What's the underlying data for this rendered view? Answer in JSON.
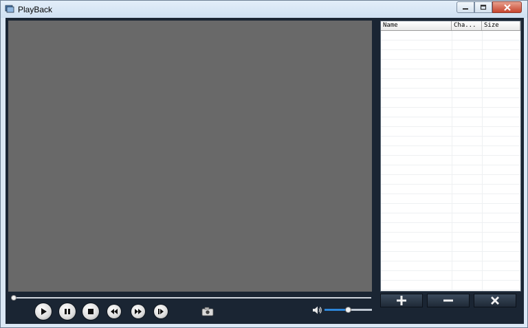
{
  "window": {
    "title": "PlayBack",
    "controls": {
      "minimize": "minimize-icon",
      "maximize": "maximize-icon",
      "close": "close-icon"
    }
  },
  "player": {
    "seek_progress": 0.0,
    "volume_level": 0.5,
    "buttons": [
      {
        "name": "play-button",
        "icon": "play-icon"
      },
      {
        "name": "pause-button",
        "icon": "pause-icon"
      },
      {
        "name": "stop-button",
        "icon": "stop-icon"
      },
      {
        "name": "rewind-button",
        "icon": "rewind-icon"
      },
      {
        "name": "fast-forward-button",
        "icon": "fast-forward-icon"
      },
      {
        "name": "step-frame-button",
        "icon": "step-frame-icon"
      }
    ],
    "snapshot_icon": "camera-icon",
    "volume_icon": "speaker-icon"
  },
  "playlist": {
    "columns": [
      "Name",
      "Cha...",
      "Size"
    ],
    "rows": [],
    "buttons": [
      {
        "name": "add-button",
        "icon": "plus-icon"
      },
      {
        "name": "remove-button",
        "icon": "minus-icon"
      },
      {
        "name": "clear-button",
        "icon": "x-icon"
      }
    ]
  },
  "colors": {
    "video_bg": "#696969",
    "panel_bg": "#1a2533",
    "volume_fill": "#2d86d9"
  }
}
